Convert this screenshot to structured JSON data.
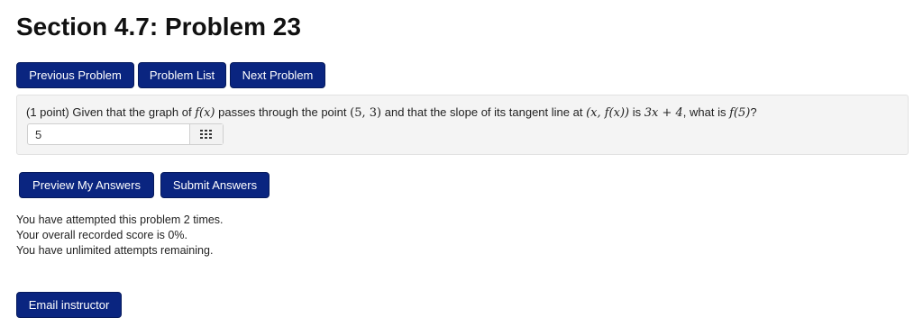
{
  "page": {
    "title": "Section 4.7: Problem 23"
  },
  "nav": {
    "previous_label": "Previous Problem",
    "list_label": "Problem List",
    "next_label": "Next Problem"
  },
  "problem": {
    "points": "(1 point)",
    "text_1": "Given that the graph of",
    "fx": "f(x)",
    "text_2": "passes through the point",
    "point": "(5, 3)",
    "text_3": "and that the slope of its tangent line at",
    "tangent_point": "(x, f(x))",
    "text_4": "is",
    "slope_expr": "3x + 4",
    "text_5": ", what is",
    "query": "f(5)",
    "text_6": "?"
  },
  "answer": {
    "value": "5",
    "icon": "keypad-icon"
  },
  "actions": {
    "preview_label": "Preview My Answers",
    "submit_label": "Submit Answers"
  },
  "status": {
    "attempts": "You have attempted this problem 2 times.",
    "score": "Your overall recorded score is 0%.",
    "remaining": "You have unlimited attempts remaining."
  },
  "footer": {
    "email_label": "Email instructor"
  },
  "colors": {
    "button_bg": "#0a2580",
    "panel_bg": "#f4f4f4"
  }
}
